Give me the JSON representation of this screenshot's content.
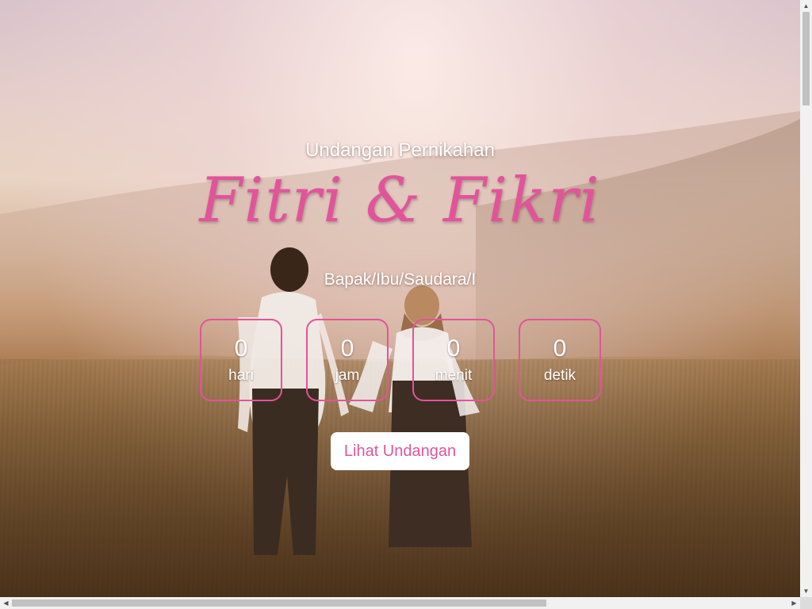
{
  "hero": {
    "subtitle": "Undangan Pernikahan",
    "names": "Fitri & Fikri",
    "guest_greeting": "Bapak/Ibu/Saudara/I",
    "background_image": "couple-in-misty-meadow"
  },
  "countdown": [
    {
      "value": "0",
      "unit": "hari"
    },
    {
      "value": "0",
      "unit": "jam"
    },
    {
      "value": "0",
      "unit": "menit"
    },
    {
      "value": "0",
      "unit": "detik"
    }
  ],
  "cta": {
    "label": "Lihat Undangan"
  },
  "colors": {
    "accent": "#e0559a",
    "text": "#ffffff",
    "button_bg": "#ffffff"
  },
  "scrollbars": {
    "up_arrow": "▲",
    "down_arrow": "▼",
    "left_arrow": "◀",
    "right_arrow": "▶"
  }
}
